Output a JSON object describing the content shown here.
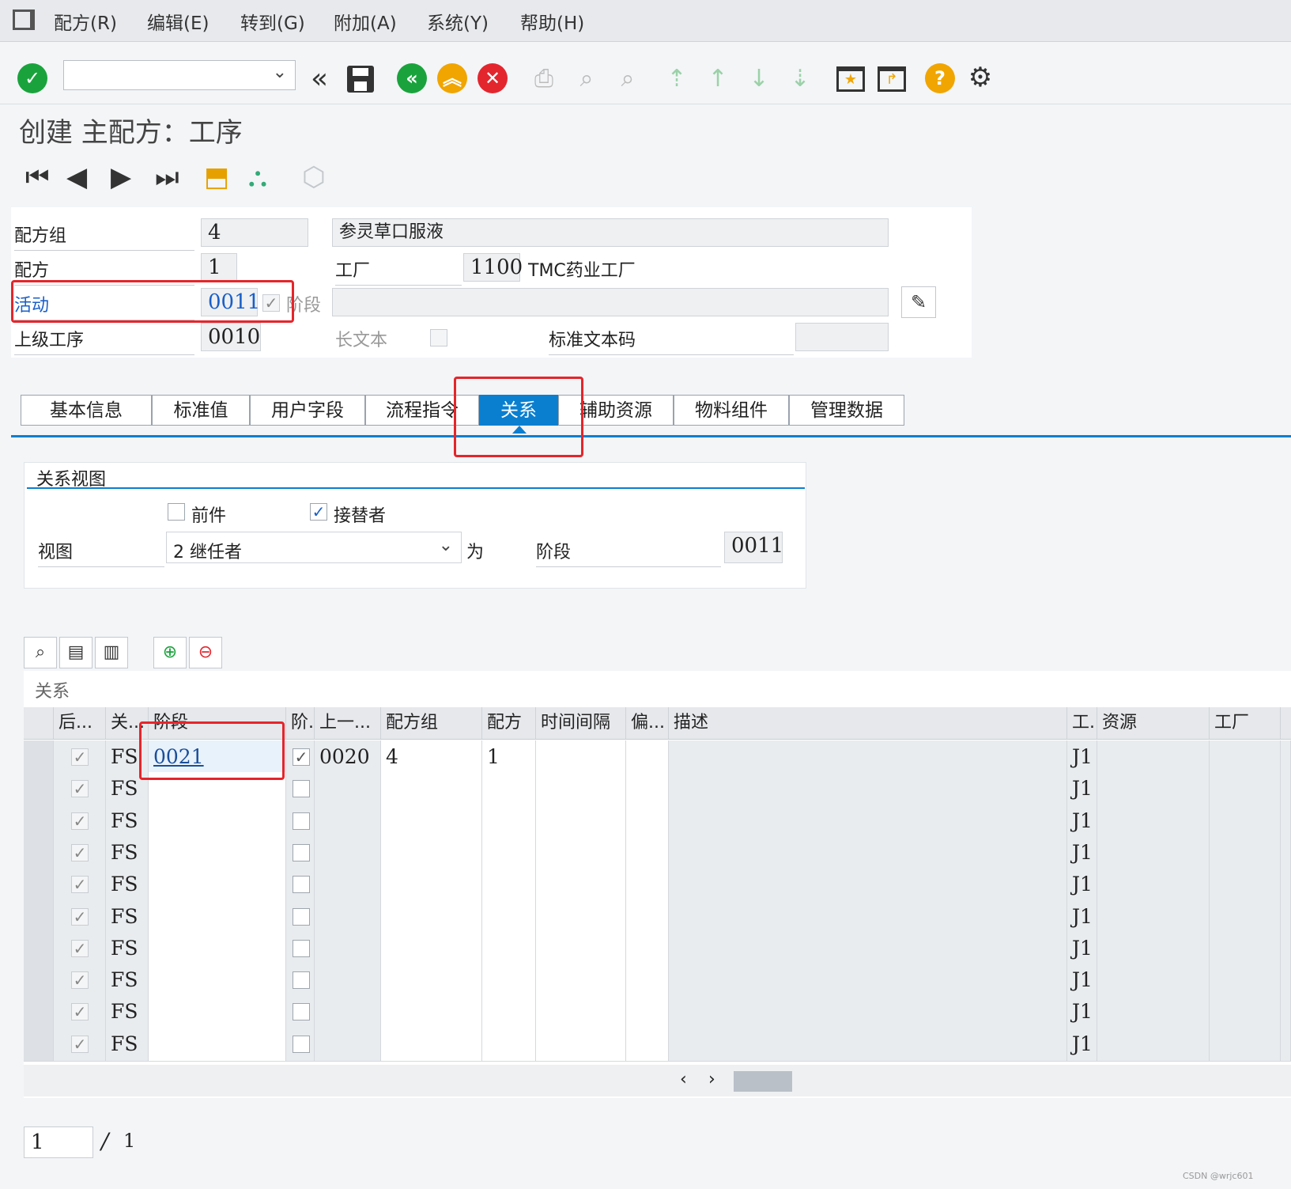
{
  "menu": {
    "items": [
      "配方(R)",
      "编辑(E)",
      "转到(G)",
      "附加(A)",
      "系统(Y)",
      "帮助(H)"
    ]
  },
  "page": {
    "title": "创建 主配方：工序"
  },
  "header": {
    "recipe_group_label": "配方组",
    "recipe_group_value": "4",
    "recipe_group_desc": "参灵草口服液",
    "recipe_label": "配方",
    "recipe_value": "1",
    "plant_label": "工厂",
    "plant_value": "1100",
    "plant_desc": "TMC药业工厂",
    "activity_label": "活动",
    "activity_value": "0011",
    "phase_label": "阶段",
    "parent_op_label": "上级工序",
    "parent_op_value": "0010",
    "long_text_label": "长文本",
    "std_text_label": "标准文本码"
  },
  "tabs": [
    {
      "label": "基本信息"
    },
    {
      "label": "标准值"
    },
    {
      "label": "用户字段"
    },
    {
      "label": "流程指令"
    },
    {
      "label": "关系"
    },
    {
      "label": "辅助资源"
    },
    {
      "label": "物料组件"
    },
    {
      "label": "管理数据"
    }
  ],
  "relation_view": {
    "group_title": "关系视图",
    "predecessor_label": "前件",
    "successor_label": "接替者",
    "view_label": "视图",
    "view_value": "2 继任者",
    "for_label": "为",
    "phase_label": "阶段",
    "phase_value": "0011"
  },
  "table": {
    "title": "关系",
    "columns": [
      "后...",
      "关...",
      "阶段",
      "阶.",
      "上一...",
      "配方组",
      "配方",
      "时间间隔",
      "偏...",
      "描述",
      "工.",
      "资源",
      "工厂"
    ],
    "rows": [
      {
        "type": "FS",
        "phase": "0021",
        "prev": "0020",
        "group": "4",
        "recipe": "1",
        "wc": "J1"
      },
      {
        "type": "FS",
        "phase": "",
        "prev": "",
        "group": "",
        "recipe": "",
        "wc": "J1"
      },
      {
        "type": "FS",
        "phase": "",
        "prev": "",
        "group": "",
        "recipe": "",
        "wc": "J1"
      },
      {
        "type": "FS",
        "phase": "",
        "prev": "",
        "group": "",
        "recipe": "",
        "wc": "J1"
      },
      {
        "type": "FS",
        "phase": "",
        "prev": "",
        "group": "",
        "recipe": "",
        "wc": "J1"
      },
      {
        "type": "FS",
        "phase": "",
        "prev": "",
        "group": "",
        "recipe": "",
        "wc": "J1"
      },
      {
        "type": "FS",
        "phase": "",
        "prev": "",
        "group": "",
        "recipe": "",
        "wc": "J1"
      },
      {
        "type": "FS",
        "phase": "",
        "prev": "",
        "group": "",
        "recipe": "",
        "wc": "J1"
      },
      {
        "type": "FS",
        "phase": "",
        "prev": "",
        "group": "",
        "recipe": "",
        "wc": "J1"
      },
      {
        "type": "FS",
        "phase": "",
        "prev": "",
        "group": "",
        "recipe": "",
        "wc": "J1"
      }
    ]
  },
  "pager": {
    "current": "1",
    "separator": "/",
    "total": "1"
  },
  "watermark": "CSDN @wrjc601",
  "colors": {
    "accent": "#0a7fd0",
    "highlight": "#e5252b",
    "ok": "#1aa33c",
    "cancel": "#e3262e",
    "warn": "#f0a500"
  },
  "icons": [
    "menu-icon",
    "check-icon",
    "back-icon",
    "save-icon",
    "exit-icon",
    "up-icon",
    "cancel-icon",
    "print-icon",
    "find-icon",
    "find-next-icon",
    "first-page-icon",
    "prev-page-icon",
    "next-page-icon",
    "last-page-icon",
    "new-session-icon",
    "shortcut-icon",
    "help-icon",
    "settings-icon",
    "edit-pencil-icon"
  ]
}
